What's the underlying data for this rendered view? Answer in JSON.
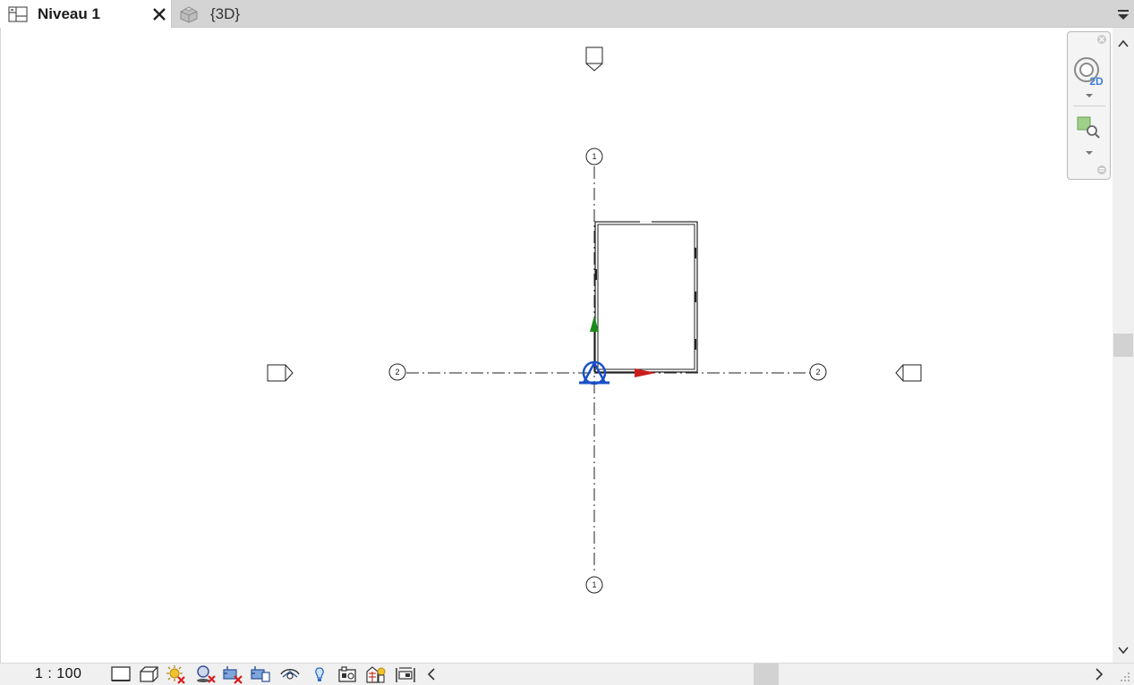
{
  "tabs": [
    {
      "label": "Niveau 1",
      "icon": "floor-plan-icon",
      "active": true
    },
    {
      "label": "{3D}",
      "icon": "3d-house-icon",
      "active": false
    }
  ],
  "canvas": {
    "grid_top_label": "1",
    "grid_bottom_label": "1",
    "grid_left_label": "2",
    "grid_right_label": "2"
  },
  "navigation_bar": {
    "wheel_badge": "2D"
  },
  "status_bar": {
    "scale": "1 : 100",
    "icons": [
      "detail-level-icon",
      "visual-style-icon",
      "sun-path-icon",
      "shadows-icon",
      "crop-view-icon",
      "show-crop-region-icon",
      "temporary-hide-icon",
      "reveal-hidden-icon",
      "temporary-view-properties-icon",
      "analytical-model-icon",
      "highlight-displacement-icon"
    ]
  },
  "colors": {
    "tab_bar": "#d4d4d4",
    "origin_blue": "#1a4fc7",
    "axis_red": "#cc1d1d",
    "axis_green": "#1a8a1a",
    "nav_blue": "#3b7dd8"
  }
}
